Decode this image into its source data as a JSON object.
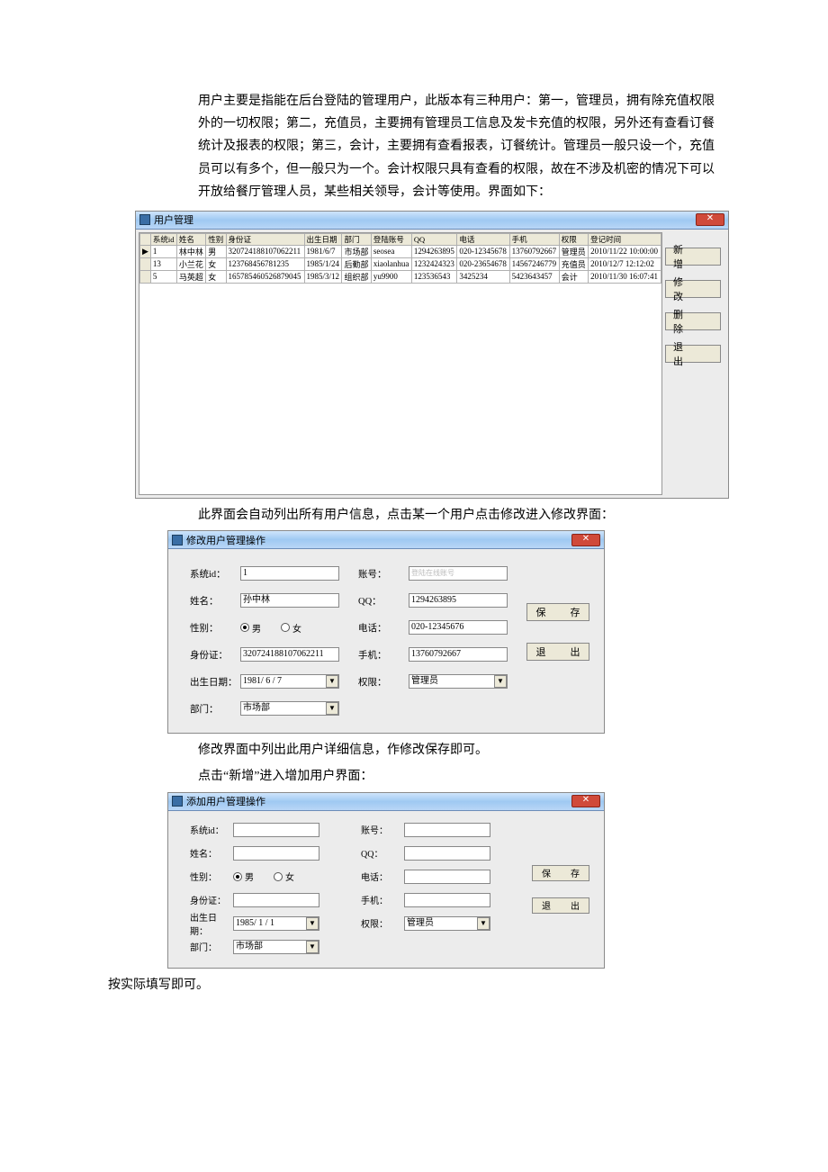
{
  "intro": "用户主要是指能在后台登陆的管理用户，此版本有三种用户：第一，管理员，拥有除充值权限外的一切权限；第二，充值员，主要拥有管理员工信息及发卡充值的权限，另外还有查看订餐统计及报表的权限；第三，会计，主要拥有查看报表，订餐统计。管理员一般只设一个，充值员可以有多个，但一般只为一个。会计权限只具有查看的权限，故在不涉及机密的情况下可以开放给餐厅管理人员，某些相关领导，会计等使用。界面如下：",
  "mainWin": {
    "title": "用户管理",
    "columns": [
      "系统id",
      "姓名",
      "性别",
      "身份证",
      "出生日期",
      "部门",
      "登陆账号",
      "QQ",
      "电话",
      "手机",
      "权限",
      "登记时间"
    ],
    "rows": [
      {
        "marker": "▶",
        "c": [
          "1",
          "林中林",
          "男",
          "320724188107062211",
          "1981/6/7",
          "市场部",
          "seosea",
          "1294263895",
          "020-12345678",
          "13760792667",
          "管理员",
          "2010/11/22 10:00:00"
        ]
      },
      {
        "marker": "",
        "c": [
          "13",
          "小兰花",
          "女",
          "123768456781235",
          "1985/1/24",
          "后勤部",
          "xiaolanhua",
          "1232424323",
          "020-23654678",
          "14567246779",
          "充值员",
          "2010/12/7 12:12:02"
        ]
      },
      {
        "marker": "",
        "c": [
          "5",
          "马英超",
          "女",
          "165785460526879045",
          "1985/3/12",
          "组织部",
          "yu9900",
          "123536543",
          "3425234",
          "5423643457",
          "会计",
          "2010/11/30 16:07:41"
        ]
      }
    ],
    "btns": {
      "add": "新　增",
      "edit": "修　改",
      "del": "删　除",
      "quit": "退　出"
    }
  },
  "caption1": "此界面会自动列出所有用户信息，点击某一个用户点击修改进入修改界面：",
  "editWin": {
    "title": "修改用户管理操作",
    "labels": {
      "sysid": "系统id：",
      "name": "姓名：",
      "sex": "性别：",
      "idcard": "身份证：",
      "birth": "出生日期：",
      "dept": "部门：",
      "acct": "账号：",
      "qq": "QQ：",
      "tel": "电话：",
      "mobile": "手机：",
      "perm": "权限："
    },
    "values": {
      "sysid": "1",
      "name": "孙中林",
      "idcard": "320724188107062211",
      "birth": "1981/ 6 / 7",
      "dept": "市场部",
      "acct_ph": "登陆在线账号",
      "qq": "1294263895",
      "tel": "020-12345676",
      "mobile": "13760792667",
      "perm": "管理员"
    },
    "sex": {
      "male": "男",
      "female": "女",
      "selected": "male"
    },
    "btns": {
      "save": "保　存",
      "quit": "退　出"
    }
  },
  "caption2a": "修改界面中列出此用户详细信息，作修改保存即可。",
  "caption2b": "点击“新增”进入增加用户界面：",
  "addWin": {
    "title": "添加用户管理操作",
    "labels": {
      "sysid": "系统id：",
      "name": "姓名：",
      "sex": "性别：",
      "idcard": "身份证：",
      "birth": "出生日期：",
      "dept": "部门：",
      "acct": "账号：",
      "qq": "QQ：",
      "tel": "电话：",
      "mobile": "手机：",
      "perm": "权限："
    },
    "values": {
      "birth": "1985/ 1 / 1",
      "dept": "市场部",
      "perm": "管理员"
    },
    "sex": {
      "male": "男",
      "female": "女",
      "selected": "male"
    },
    "btns": {
      "save": "保　存",
      "quit": "退　出"
    }
  },
  "footer": "按实际填写即可。"
}
